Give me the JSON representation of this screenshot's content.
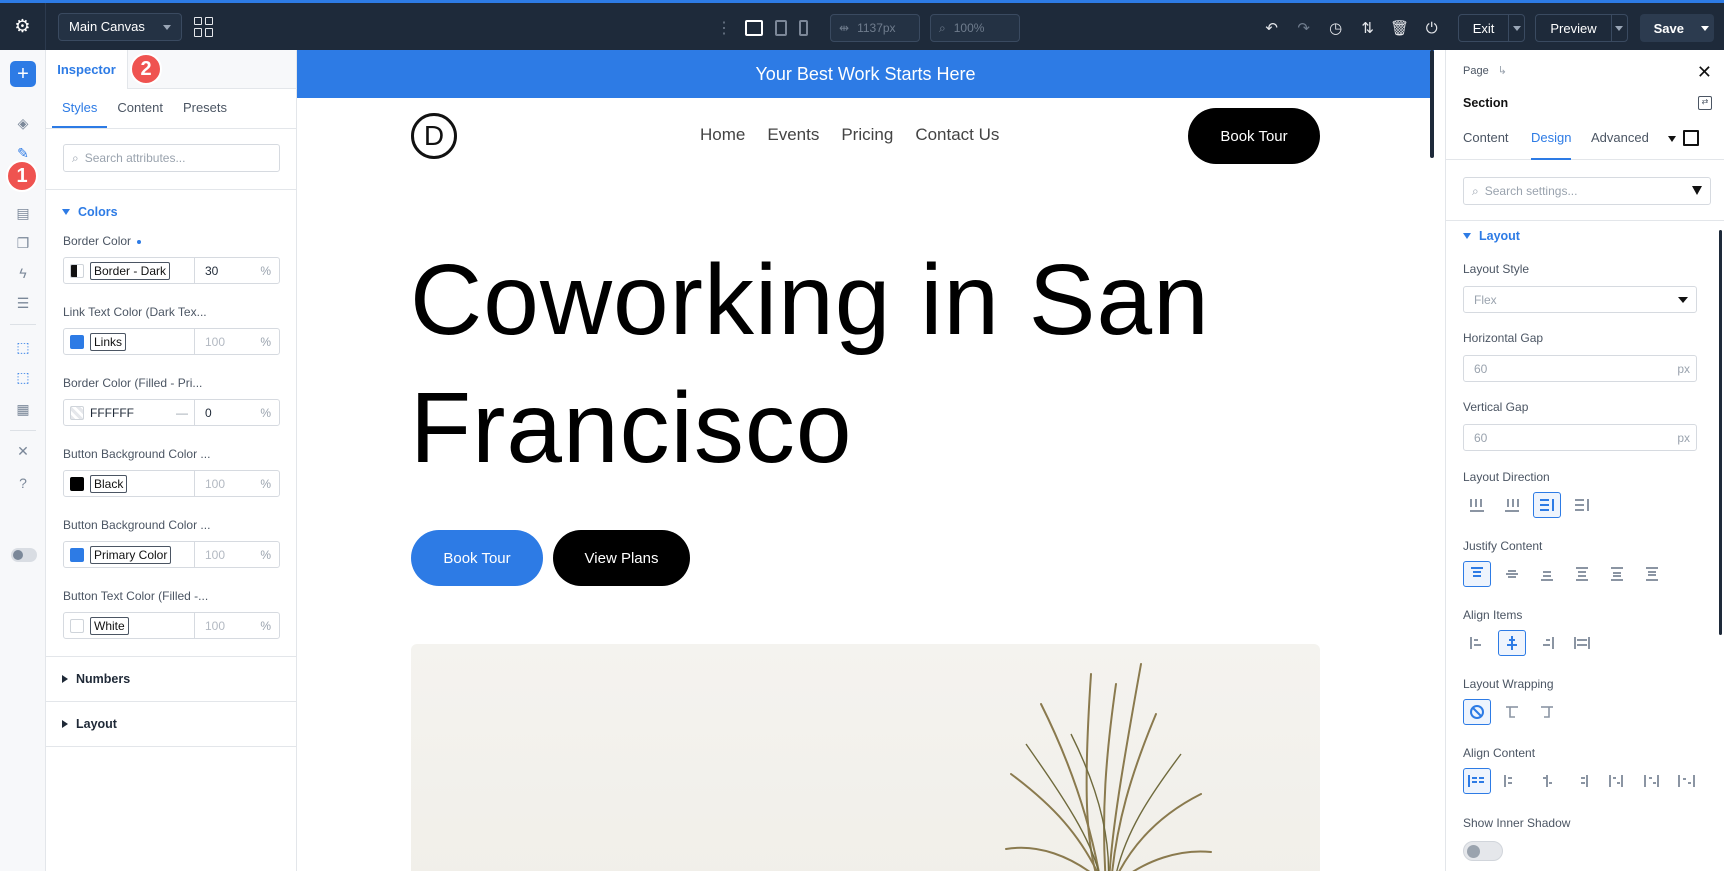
{
  "topbar": {
    "canvas_select": "Main Canvas",
    "width_value": "1137px",
    "zoom_value": "100%",
    "exit_label": "Exit",
    "preview_label": "Preview",
    "save_label": "Save"
  },
  "badges": {
    "one": "1",
    "two": "2"
  },
  "inspector": {
    "tab_label": "Inspector",
    "subtabs": [
      "Styles",
      "Content",
      "Presets"
    ],
    "search_placeholder": "Search attributes...",
    "colors_group": "Colors",
    "attributes": [
      {
        "label": "Border Color",
        "value": "Border - Dark",
        "opacity": "30",
        "unit": "%",
        "swatch": "#444444"
      },
      {
        "label": "Link Text Color (Dark Tex...",
        "value": "Links",
        "opacity": "100",
        "unit": "%",
        "swatch": "#2d7be5"
      },
      {
        "label": "Border Color (Filled - Pri...",
        "value": "FFFFFF",
        "opacity": "0",
        "unit": "%",
        "swatch": "#ffffff"
      },
      {
        "label": "Button Background Color ...",
        "value": "Black",
        "opacity": "100",
        "unit": "%",
        "swatch": "#000000"
      },
      {
        "label": "Button Background Color ...",
        "value": "Primary Color",
        "opacity": "100",
        "unit": "%",
        "swatch": "#2d7be5"
      },
      {
        "label": "Button Text Color (Filled -...",
        "value": "White",
        "opacity": "100",
        "unit": "%",
        "swatch": "#ffffff"
      }
    ],
    "numbers_group": "Numbers",
    "layout_group": "Layout"
  },
  "canvas": {
    "banner": "Your Best Work Starts Here",
    "logo_letter": "D",
    "menu": [
      "Home",
      "Events",
      "Pricing",
      "Contact Us"
    ],
    "nav_button": "Book Tour",
    "hero_line1": "Coworking in San",
    "hero_line2": "Francisco",
    "cta_primary": "Book Tour",
    "cta_secondary": "View Plans"
  },
  "right_panel": {
    "breadcrumb": "Page",
    "section_title": "Section",
    "tabs": [
      "Content",
      "Design",
      "Advanced"
    ],
    "search_placeholder": "Search settings...",
    "layout_group": "Layout",
    "layout_style_label": "Layout Style",
    "layout_style_value": "Flex",
    "horizontal_gap_label": "Horizontal Gap",
    "horizontal_gap_value": "60",
    "vertical_gap_label": "Vertical Gap",
    "vertical_gap_value": "60",
    "gap_unit": "px",
    "layout_direction_label": "Layout Direction",
    "justify_content_label": "Justify Content",
    "align_items_label": "Align Items",
    "layout_wrapping_label": "Layout Wrapping",
    "align_content_label": "Align Content",
    "inner_shadow_label": "Show Inner Shadow"
  },
  "colors": {
    "accent": "#2d7be5",
    "topbar": "#1e2a3a",
    "badge": "#ef5350"
  }
}
